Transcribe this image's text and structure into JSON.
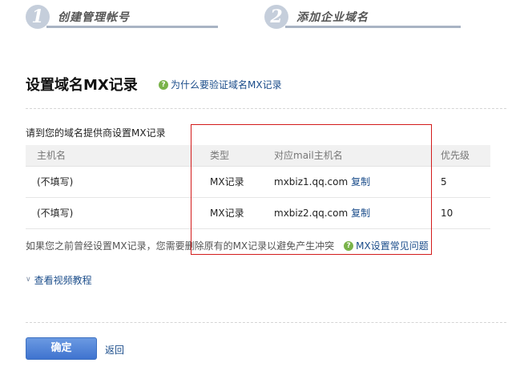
{
  "steps": [
    {
      "number": "1",
      "label": "创建管理帐号"
    },
    {
      "number": "2",
      "label": "添加企业域名"
    }
  ],
  "title": "设置域名MX记录",
  "help_link": "为什么要验证域名MX记录",
  "section_label": "请到您的域名提供商设置MX记录",
  "table": {
    "headers": [
      "主机名",
      "类型",
      "对应mail主机名",
      "优先级"
    ],
    "rows": [
      {
        "host": "(不填写)",
        "type": "MX记录",
        "mail_host": "mxbiz1.qq.com",
        "copy": "复制",
        "priority": "5"
      },
      {
        "host": "(不填写)",
        "type": "MX记录",
        "mail_host": "mxbiz2.qq.com",
        "copy": "复制",
        "priority": "10"
      }
    ]
  },
  "note": "如果您之前曾经设置MX记录，您需要删除原有的MX记录以避免产生冲突",
  "faq_link": "MX设置常见问题",
  "video_link": "查看视频教程",
  "confirm_button": "确定",
  "back_link": "返回",
  "colors": {
    "link": "#1a4c8a",
    "highlight_box": "#d31b1b",
    "button": "#4a7fd6",
    "help_icon": "#7ab34a"
  }
}
